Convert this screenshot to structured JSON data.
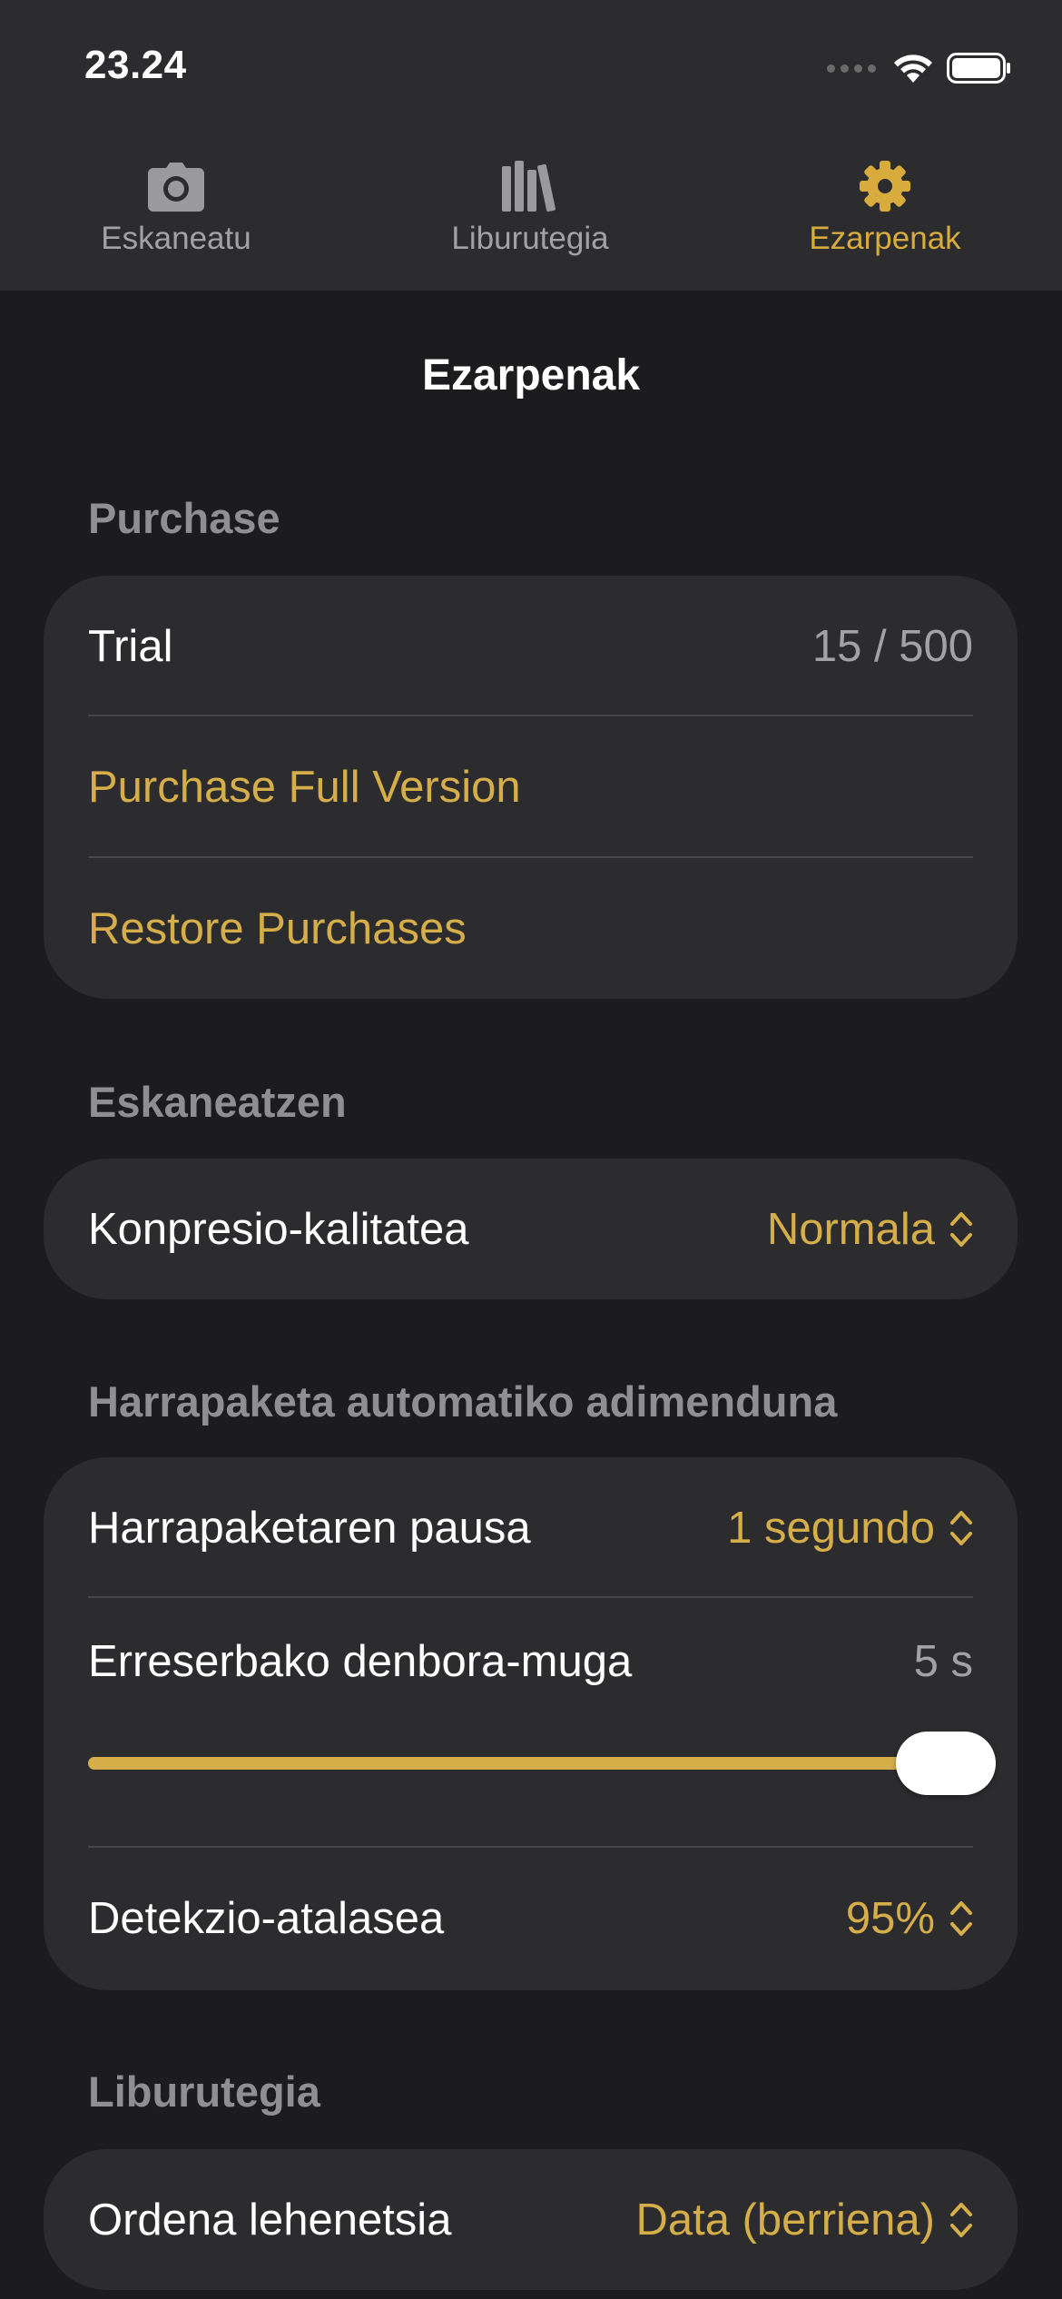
{
  "status_bar": {
    "time": "23.24"
  },
  "tabs": [
    {
      "label": "Eskaneatu",
      "icon": "camera-icon",
      "active": false
    },
    {
      "label": "Liburutegia",
      "icon": "library-icon",
      "active": false
    },
    {
      "label": "Ezarpenak",
      "icon": "gear-icon",
      "active": true
    }
  ],
  "nav": {
    "title": "Ezarpenak"
  },
  "colors": {
    "accent": "#d5ae4a",
    "background": "#1c1c1e",
    "card": "#2c2c2e",
    "secondary_text": "#8e8e93"
  },
  "sections": {
    "purchase": {
      "header": "Purchase",
      "trial_label": "Trial",
      "trial_value": "15 / 500",
      "purchase_full": "Purchase Full Version",
      "restore": "Restore Purchases"
    },
    "scanning": {
      "header": "Eskaneatzen",
      "compression_label": "Konpresio-kalitatea",
      "compression_value": "Normala"
    },
    "auto_capture": {
      "header": "Harrapaketa automatiko adimenduna",
      "pause_label": "Harrapaketaren pausa",
      "pause_value": "1 segundo",
      "timeout_label": "Erreserbako denbora-muga",
      "timeout_value": "5 s",
      "timeout_slider_fraction": 1.0,
      "threshold_label": "Detekzio-atalasea",
      "threshold_value": "95%"
    },
    "library": {
      "header": "Liburutegia",
      "sort_label": "Ordena lehenetsia",
      "sort_value": "Data (berriena)"
    }
  }
}
